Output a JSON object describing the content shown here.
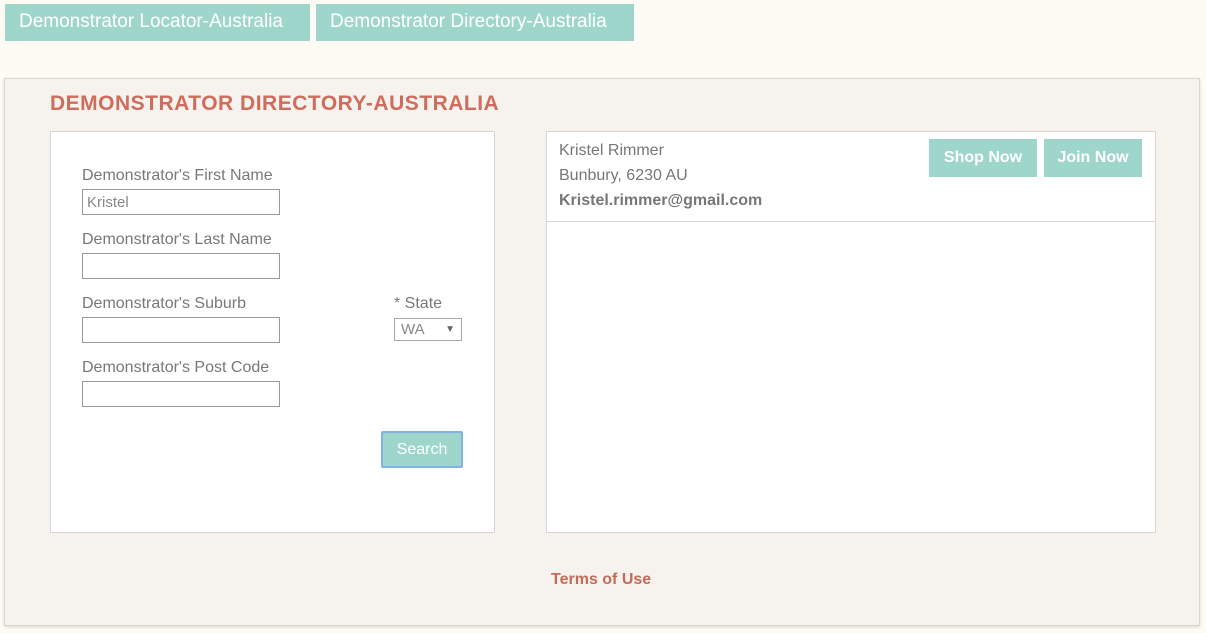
{
  "tabs": [
    {
      "label": "Demonstrator Locator-Australia"
    },
    {
      "label": "Demonstrator Directory-Australia"
    }
  ],
  "page": {
    "title": "DEMONSTRATOR DIRECTORY-AUSTRALIA"
  },
  "form": {
    "first_name_label": "Demonstrator's First Name",
    "first_name_value": "Kristel",
    "last_name_label": "Demonstrator's Last Name",
    "last_name_value": "",
    "suburb_label": "Demonstrator's Suburb",
    "suburb_value": "",
    "state_label": "* State",
    "state_value": "WA",
    "postcode_label": "Demonstrator's Post Code",
    "postcode_value": "",
    "search_label": "Search"
  },
  "results": [
    {
      "name": "Kristel Rimmer",
      "location": "Bunbury, 6230 AU",
      "email": "Kristel.rimmer@gmail.com",
      "shop_label": "Shop Now",
      "join_label": "Join Now"
    }
  ],
  "footer": {
    "terms_label": "Terms of Use"
  },
  "colors": {
    "accent_teal": "#9fd6cc",
    "title_red": "#cf6d5c",
    "background": "#fefbf4"
  }
}
